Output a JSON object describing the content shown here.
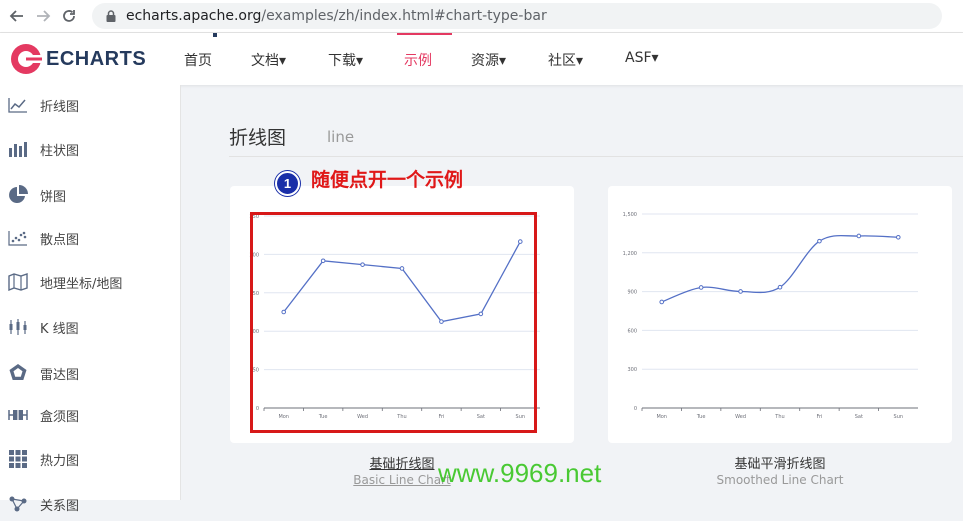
{
  "browser": {
    "url_host": "echarts.apache.org",
    "url_path": "/examples/zh/index.html#chart-type-bar"
  },
  "header": {
    "logo_text": "ECHARTS",
    "menu": [
      {
        "label": "首页"
      },
      {
        "label": "文档▾"
      },
      {
        "label": "下载▾"
      },
      {
        "label": "示例"
      },
      {
        "label": "资源▾"
      },
      {
        "label": "社区▾"
      },
      {
        "label": "ASF▾"
      }
    ],
    "active_color": "#e43961"
  },
  "sidebar": {
    "items": [
      {
        "label": "折线图",
        "icon": "line-chart-icon"
      },
      {
        "label": "柱状图",
        "icon": "bar-chart-icon"
      },
      {
        "label": "饼图",
        "icon": "pie-chart-icon"
      },
      {
        "label": "散点图",
        "icon": "scatter-chart-icon"
      },
      {
        "label": "地理坐标/地图",
        "icon": "map-icon"
      },
      {
        "label": "K 线图",
        "icon": "candlestick-icon"
      },
      {
        "label": "雷达图",
        "icon": "radar-icon"
      },
      {
        "label": "盒须图",
        "icon": "boxplot-icon"
      },
      {
        "label": "热力图",
        "icon": "heatmap-icon"
      },
      {
        "label": "关系图",
        "icon": "graph-icon"
      }
    ]
  },
  "main": {
    "section_title": "折线图",
    "section_subtitle": "line",
    "cards": [
      {
        "caption": "基础折线图",
        "caption_sub": "Basic Line Chart"
      },
      {
        "caption": "基础平滑折线图",
        "caption_sub": "Smoothed Line Chart"
      }
    ]
  },
  "annotation": {
    "badge": "1",
    "text": "随便点开一个示例",
    "color": "#e01818"
  },
  "watermark": "www.9969.net",
  "chart_data": [
    {
      "type": "line",
      "categories": [
        "Mon",
        "Tue",
        "Wed",
        "Thu",
        "Fri",
        "Sat",
        "Sun"
      ],
      "values": [
        150,
        230,
        224,
        218,
        135,
        147,
        260
      ],
      "ylim": [
        0,
        300
      ],
      "yticks": [
        "0",
        "50",
        "100",
        "150",
        "200",
        "250"
      ],
      "line_color": "#5470c6"
    },
    {
      "type": "line",
      "smooth": true,
      "categories": [
        "Mon",
        "Tue",
        "Wed",
        "Thu",
        "Fri",
        "Sat",
        "Sun"
      ],
      "values": [
        820,
        932,
        901,
        934,
        1290,
        1330,
        1320
      ],
      "ylim": [
        0,
        1500
      ],
      "yticks": [
        "0",
        "300",
        "600",
        "900",
        "1,200",
        "1,500"
      ],
      "line_color": "#5470c6"
    }
  ]
}
